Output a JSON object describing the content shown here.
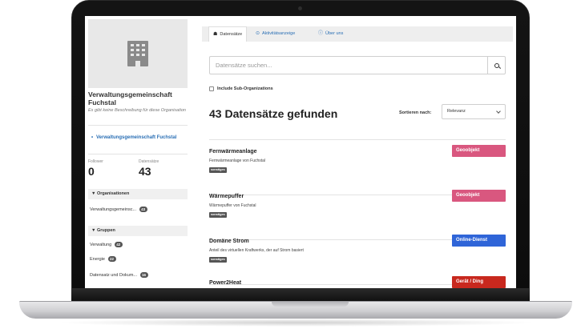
{
  "colors": {
    "link": "#2a6fb5",
    "geoobjekt": "#d9577f",
    "online_dienst": "#2f65d8",
    "geraet_ding": "#c8281e"
  },
  "sidebar": {
    "organization_title": "Verwaltungsgemeinschaft Fuchstal",
    "organization_description": "Es gibt keine Beschreibung für diese Organisation",
    "organization_link": "Verwaltungsgemeinschaft Fuchstal",
    "followers_label": "Follower",
    "followers_value": "0",
    "datasets_label": "Datensätze",
    "datasets_value": "43",
    "organizations_heading": "Organisationen",
    "organizations": [
      {
        "label": "Verwaltungsgemeinsc...",
        "count": "43"
      }
    ],
    "groups_heading": "Gruppen",
    "groups": [
      {
        "label": "Verwaltung",
        "count": "42"
      },
      {
        "label": "Energie",
        "count": "22"
      },
      {
        "label": "Datensatz und Dokum...",
        "count": "16"
      }
    ]
  },
  "tabs": [
    {
      "label": "Datensätze",
      "icon": "sitemap-icon"
    },
    {
      "label": "Aktivitätsanzeige",
      "icon": "clock-icon"
    },
    {
      "label": "Über uns",
      "icon": "info-icon"
    }
  ],
  "search": {
    "placeholder": "Datensätze suchen...",
    "value": ""
  },
  "filters": {
    "include_sub_orgs_label": "Include Sub-Organizations",
    "include_sub_orgs_checked": false
  },
  "results": {
    "count_heading": "43 Datensätze gefunden",
    "sort_label": "Sortieren nach:",
    "sort_value": "Relevanz"
  },
  "datasets": [
    {
      "title": "Fernwärmeanlage",
      "description": "Fernwärmeanlage von Fuchstal",
      "tag": "sonstiges",
      "type": "Geoobjekt",
      "type_color": "#d9577f"
    },
    {
      "title": "Wärmepuffer",
      "description": "Wärmepuffer von Fuchstal",
      "tag": "sonstiges",
      "type": "Geoobjekt",
      "type_color": "#d9577f"
    },
    {
      "title": "Domäne Strom",
      "description": "Anteil des virtuellen Kraftwerks, der auf Strom basiert",
      "tag": "sonstiges",
      "type": "Online-Dienst",
      "type_color": "#2f65d8"
    },
    {
      "title": "Power2Heat",
      "description": "",
      "tag": "",
      "type": "Gerät / Ding",
      "type_color": "#c8281e"
    }
  ]
}
